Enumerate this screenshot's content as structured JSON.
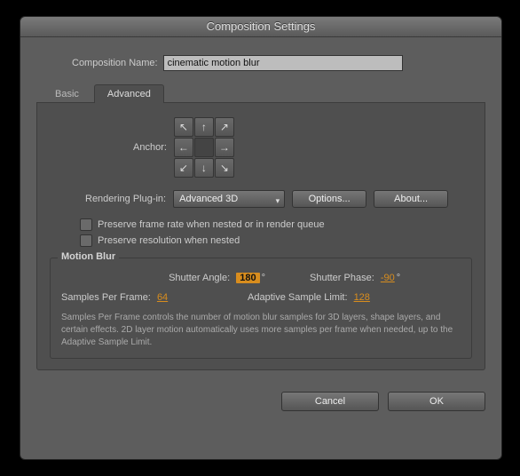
{
  "window": {
    "title": "Composition Settings"
  },
  "compName": {
    "label": "Composition Name:",
    "value": "cinematic motion blur"
  },
  "tabs": {
    "basic": "Basic",
    "advanced": "Advanced"
  },
  "anchor": {
    "label": "Anchor:"
  },
  "rendering": {
    "label": "Rendering Plug-in:",
    "selected": "Advanced 3D",
    "optionsBtn": "Options...",
    "aboutBtn": "About..."
  },
  "checks": {
    "preserveFrameRate": "Preserve frame rate when nested or in render queue",
    "preserveResolution": "Preserve resolution when nested"
  },
  "motionBlur": {
    "legend": "Motion Blur",
    "shutterAngleLabel": "Shutter Angle:",
    "shutterAngleValue": "180",
    "shutterPhaseLabel": "Shutter Phase:",
    "shutterPhaseValue": "-90",
    "degree": "°",
    "samplesLabel": "Samples Per Frame:",
    "samplesValue": "64",
    "adaptiveLabel": "Adaptive Sample Limit:",
    "adaptiveValue": "128",
    "help": "Samples Per Frame controls the number of motion blur samples for 3D layers, shape layers, and certain effects. 2D layer motion automatically uses more samples per frame when needed, up to the Adaptive Sample Limit."
  },
  "footer": {
    "cancel": "Cancel",
    "ok": "OK"
  }
}
